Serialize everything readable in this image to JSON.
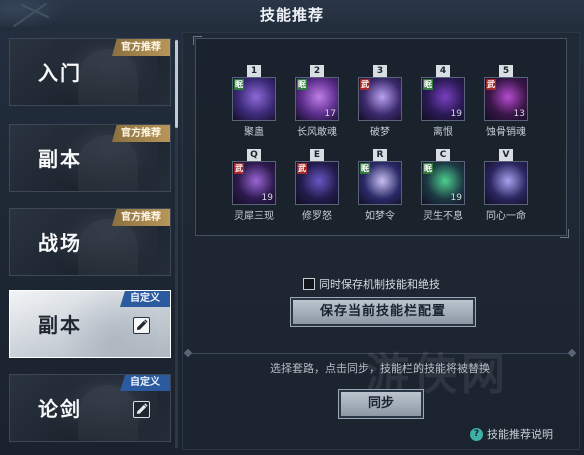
{
  "window": {
    "title": "技能推荐"
  },
  "sidebar": {
    "items": [
      {
        "label": "入门",
        "tag": "官方推荐",
        "type": "official"
      },
      {
        "label": "副本",
        "tag": "官方推荐",
        "type": "official"
      },
      {
        "label": "战场",
        "tag": "官方推荐",
        "type": "official"
      },
      {
        "label": "副本",
        "tag": "自定义",
        "type": "custom",
        "active": true
      },
      {
        "label": "论剑",
        "tag": "自定义",
        "type": "custom"
      }
    ]
  },
  "skills": [
    {
      "key": "1",
      "name": "聚蛊",
      "badge": "眠",
      "badge_color": "green",
      "count": "",
      "colors": [
        "#3b2a78",
        "#8e6ad8"
      ]
    },
    {
      "key": "2",
      "name": "长风敢魂",
      "badge": "眠",
      "badge_color": "green",
      "count": "17",
      "colors": [
        "#5a2d8a",
        "#c07ee8"
      ]
    },
    {
      "key": "3",
      "name": "破梦",
      "badge": "武",
      "badge_color": "red",
      "count": "",
      "colors": [
        "#3c2a6e",
        "#b9a2f2"
      ]
    },
    {
      "key": "4",
      "name": "离恨",
      "badge": "眠",
      "badge_color": "green",
      "count": "19",
      "colors": [
        "#2a1a55",
        "#7a3fc0"
      ]
    },
    {
      "key": "5",
      "name": "蚀骨销魂",
      "badge": "武",
      "badge_color": "red",
      "count": "13",
      "colors": [
        "#3a1648",
        "#b64ad0"
      ]
    },
    {
      "key": "Q",
      "name": "灵犀三现",
      "badge": "武",
      "badge_color": "red",
      "count": "19",
      "colors": [
        "#2e1a4e",
        "#9a66d6"
      ]
    },
    {
      "key": "E",
      "name": "修罗怒",
      "badge": "武",
      "badge_color": "red",
      "count": "",
      "colors": [
        "#221c4c",
        "#6a56c6"
      ]
    },
    {
      "key": "R",
      "name": "如梦令",
      "badge": "眠",
      "badge_color": "green",
      "count": "",
      "colors": [
        "#2a2a68",
        "#c8c0f2"
      ]
    },
    {
      "key": "C",
      "name": "灵生不息",
      "badge": "眠",
      "badge_color": "green",
      "count": "19",
      "colors": [
        "#1c3a44",
        "#4fcf8e"
      ]
    },
    {
      "key": "V",
      "name": "同心一命",
      "badge": "",
      "badge_color": "",
      "count": "",
      "colors": [
        "#2a2660",
        "#a8a2ee"
      ]
    }
  ],
  "options": {
    "save_mechanics_label": "同时保存机制技能和绝技"
  },
  "actions": {
    "save_label": "保存当前技能栏配置",
    "hint": "选择套路，点击同步，技能栏的技能将被替换",
    "sync_label": "同步",
    "help_label": "技能推荐说明",
    "help_icon": "?"
  },
  "watermark": "游侠网"
}
